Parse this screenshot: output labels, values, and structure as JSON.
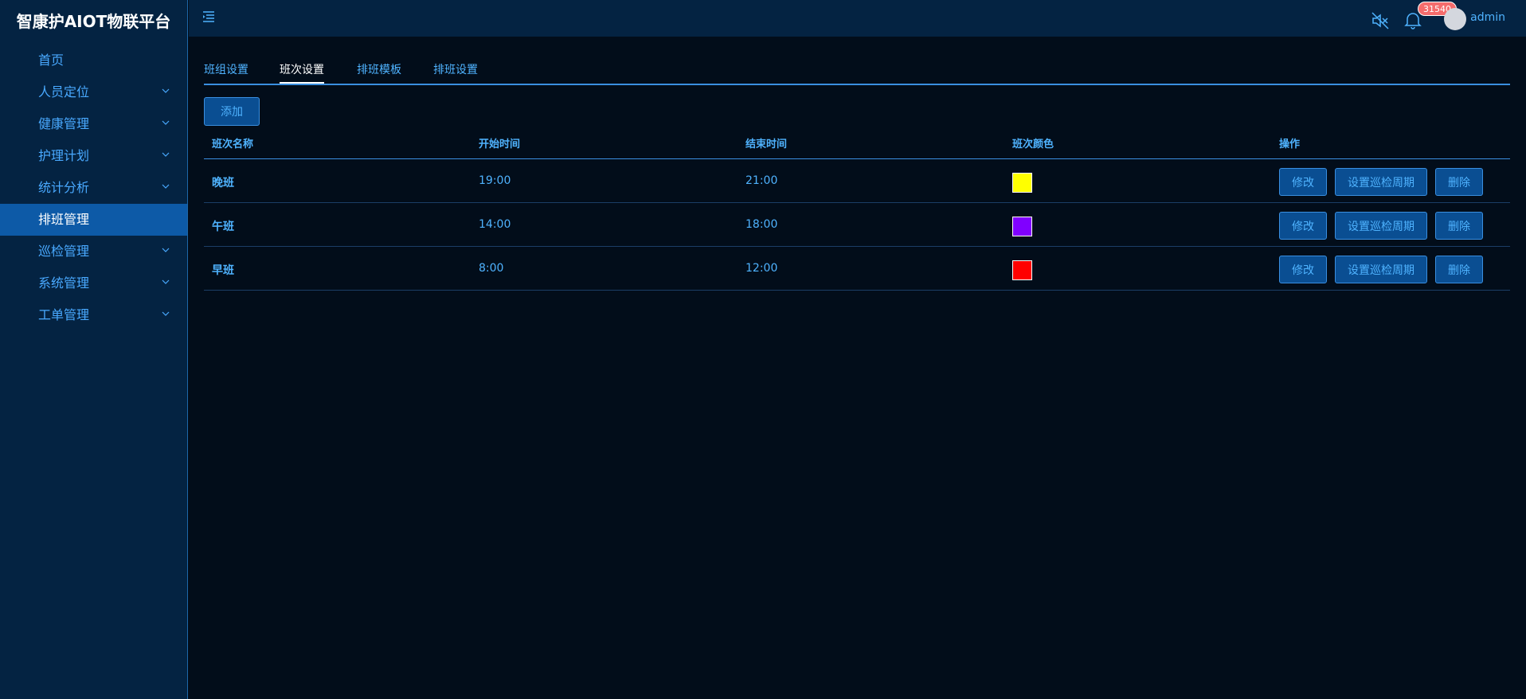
{
  "brand": "智康护AIOT物联平台",
  "menu": [
    {
      "label": "首页"
    },
    {
      "label": "人员定位"
    },
    {
      "label": "健康管理"
    },
    {
      "label": "护理计划"
    },
    {
      "label": "统计分析"
    },
    {
      "label": "排班管理"
    },
    {
      "label": "巡检管理"
    },
    {
      "label": "系统管理"
    },
    {
      "label": "工单管理"
    }
  ],
  "header": {
    "badge": "31540",
    "username": "admin"
  },
  "tabs": [
    {
      "label": "班组设置"
    },
    {
      "label": "班次设置"
    },
    {
      "label": "排班模板"
    },
    {
      "label": "排班设置"
    }
  ],
  "add_label": "添加",
  "table": {
    "columns": [
      "班次名称",
      "开始时间",
      "结束时间",
      "班次颜色",
      "操作"
    ],
    "rows": [
      {
        "name": "晚班",
        "start": "19:00",
        "end": "21:00",
        "color": "#ffff00"
      },
      {
        "name": "午班",
        "start": "14:00",
        "end": "18:00",
        "color": "#8000ff"
      },
      {
        "name": "早班",
        "start": "8:00",
        "end": "12:00",
        "color": "#ff0000"
      }
    ],
    "actions": {
      "edit": "修改",
      "period": "设置巡检周期",
      "delete": "删除"
    }
  },
  "colors": {
    "sidebar": "#042342",
    "active": "#0d5aa7",
    "accent": "#4fb3ff",
    "background": "#020d1a"
  }
}
